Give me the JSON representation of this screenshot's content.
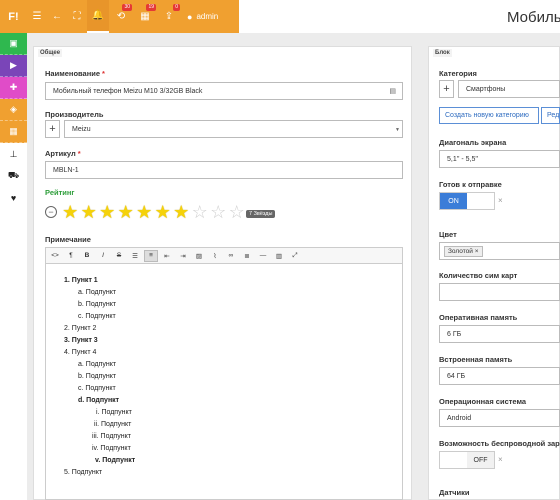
{
  "header": {
    "logo": "F!",
    "title": "Мобиль",
    "user": "admin",
    "badges": {
      "history": "30",
      "calendar": "19",
      "upload": "0"
    }
  },
  "colors": {
    "accent": "#f0a030",
    "sidebar": [
      "#2fb84f",
      "#7a45b8",
      "#e04cc8",
      "#f0a030",
      "#f0a030"
    ]
  },
  "panels": {
    "left_label": "Общее",
    "right_label": "Блок"
  },
  "general": {
    "name_label": "Наименование",
    "name_value": "Мобильный телефон Meizu M10 3/32GB Black",
    "maker_label": "Производитель",
    "maker_value": "Meizu",
    "sku_label": "Артикул",
    "sku_value": "MBLN-1",
    "rating_label": "Рейтинг",
    "rating_value": 7,
    "rating_max": 10,
    "rating_badge": "7 Звёзды",
    "note_label": "Примечание"
  },
  "note_lines": [
    {
      "text": "1.  Пункт 1",
      "bold": true
    },
    {
      "text": "a.  Подпункт"
    },
    {
      "text": "b.  Подпункт"
    },
    {
      "text": "c.  Подпункт"
    },
    {
      "text": "2.  Пункт 2"
    },
    {
      "text": "3.  Пункт 3",
      "bold": true
    },
    {
      "text": "4.  Пункт 4"
    },
    {
      "text": "a.  Подпункт"
    },
    {
      "text": "b.  Подпункт"
    },
    {
      "text": "c.  Подпункт"
    },
    {
      "text": "d.  Подпункт",
      "bold": true
    },
    {
      "text": "i.  Подпункт"
    },
    {
      "text": "ii.  Подпункт"
    },
    {
      "text": "iii.  Подпункт"
    },
    {
      "text": "iv.  Подпункт"
    },
    {
      "text": "v.  Подпункт",
      "bold": true
    },
    {
      "text": "5.  Подпункт"
    }
  ],
  "block": {
    "category_label": "Категория",
    "category_value": "Смартфоны",
    "create_category": "Создать новую категорию",
    "edit_category": "Ред",
    "diagonal_label": "Диагональ экрана",
    "diagonal_value": "5,1'' - 5,5''",
    "ready_label": "Готов к отправке",
    "ready_on": "ON",
    "color_label": "Цвет",
    "color_tag": "Золотой ×",
    "sim_label": "Количество сим карт",
    "ram_label": "Оперативная память",
    "ram_value": "6 ГБ",
    "storage_label": "Встроенная память",
    "storage_value": "64 ГБ",
    "os_label": "Операционная система",
    "os_value": "Android",
    "wireless_label": "Возможность беспроводной заря",
    "wireless_off": "OFF",
    "sensors_label": "Датчики"
  }
}
